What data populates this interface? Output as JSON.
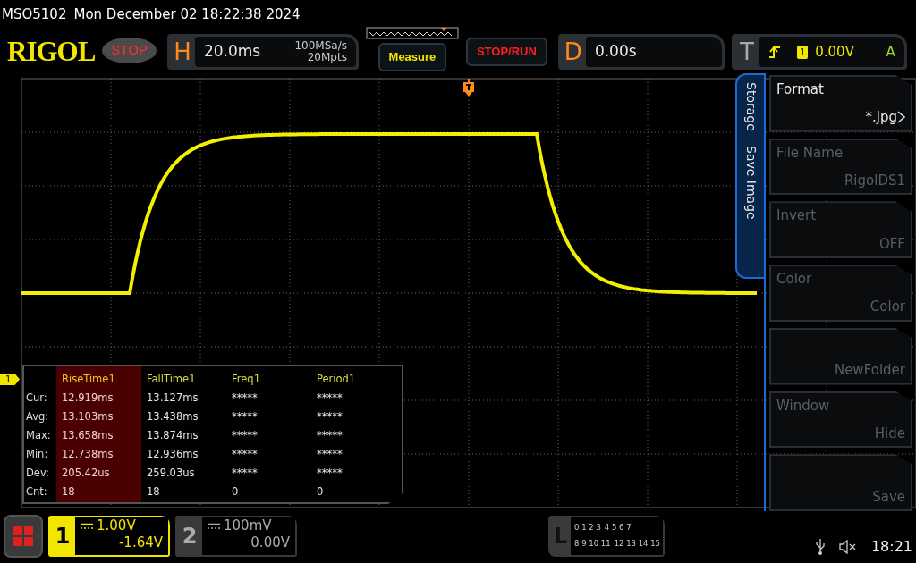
{
  "title_bar": {
    "model": "MSO5102",
    "datetime": "Mon December 02 18:22:38 2024"
  },
  "toolbar": {
    "logo": "RIGOL",
    "run_state": "STOP",
    "horizontal": {
      "label": "H",
      "timebase": "20.0ms",
      "sample_rate": "100MSa/s",
      "memory_depth": "20Mpts"
    },
    "buttons": [
      {
        "label": "Measure",
        "kind": "measure"
      },
      {
        "label": "STOP/RUN",
        "kind": "run"
      }
    ],
    "delay": {
      "label": "D",
      "value": "0.00s"
    },
    "trigger": {
      "label": "T",
      "source": "1",
      "threshold": "0.00V",
      "mode": "A"
    }
  },
  "graticule": {
    "channel_marker": "1"
  },
  "measurements": {
    "row_labels": [
      "Cur:",
      "Avg:",
      "Max:",
      "Min:",
      "Dev:",
      "Cnt:"
    ],
    "columns": [
      {
        "name": "RiseTime1",
        "selected": true,
        "values": [
          "12.919ms",
          "13.103ms",
          "13.658ms",
          "12.738ms",
          "205.42us",
          "18"
        ]
      },
      {
        "name": "FallTime1",
        "selected": false,
        "values": [
          "13.127ms",
          "13.438ms",
          "13.874ms",
          "12.936ms",
          "259.03us",
          "18"
        ]
      },
      {
        "name": "Freq1",
        "selected": false,
        "values": [
          "*****",
          "*****",
          "*****",
          "*****",
          "*****",
          "0"
        ]
      },
      {
        "name": "Period1",
        "selected": false,
        "values": [
          "*****",
          "*****",
          "*****",
          "*****",
          "*****",
          "0"
        ]
      }
    ]
  },
  "side_menu": {
    "tabs": [
      "Storage",
      "Save Image"
    ],
    "items": [
      {
        "label": "Format",
        "value": "*.jpg",
        "disabled": false,
        "submenu": true
      },
      {
        "label": "File Name",
        "value": "RigolDS1",
        "disabled": true,
        "submenu": false
      },
      {
        "label": "Invert",
        "value": "OFF",
        "disabled": true,
        "submenu": false
      },
      {
        "label": "Color",
        "value": "Color",
        "disabled": true,
        "submenu": false
      },
      {
        "value": "NewFolder",
        "disabled": true,
        "submenu": false
      },
      {
        "label": "Window",
        "value": "Hide",
        "disabled": true,
        "submenu": false
      },
      {
        "value": "Save",
        "disabled": true,
        "submenu": false
      }
    ]
  },
  "channels": [
    {
      "number": "1",
      "scale": "1.00V",
      "offset": "-1.64V",
      "active": true
    },
    {
      "number": "2",
      "scale": "100mV",
      "offset": "0.00V",
      "active": false
    }
  ],
  "digital": {
    "label": "L",
    "rows": [
      [
        "0 1 2 3",
        "4 5 6 7"
      ],
      [
        "8 9 10 11",
        "12 13 14 15"
      ]
    ]
  },
  "status": {
    "time": "18:21"
  }
}
